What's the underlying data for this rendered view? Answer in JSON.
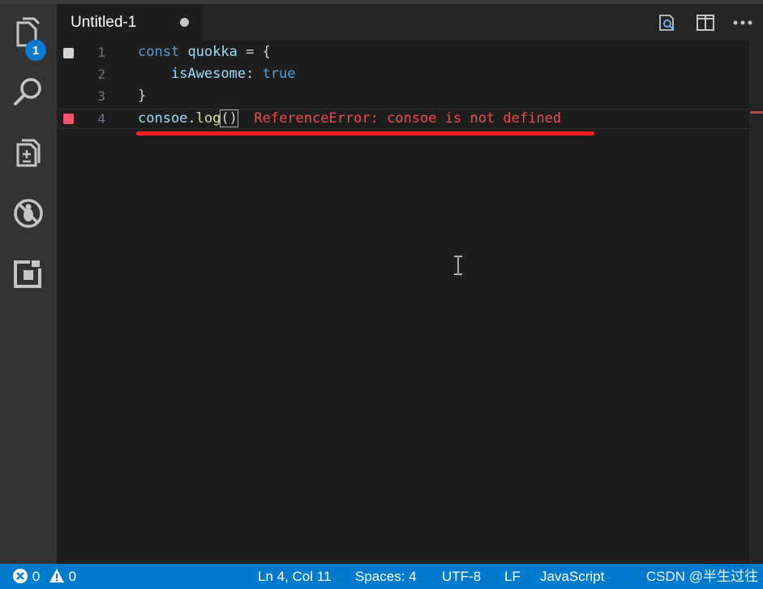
{
  "activity_bar": {
    "explorer_badge": "1",
    "items": [
      "explorer-icon",
      "search-icon",
      "source-control-icon",
      "debug-icon",
      "extensions-icon"
    ]
  },
  "tab": {
    "title": "Untitled-1",
    "dirty": true
  },
  "toolbar": {
    "icons": [
      "open-preview-icon",
      "split-editor-icon",
      "more-actions-icon"
    ]
  },
  "editor": {
    "lines": [
      {
        "number": "1",
        "coverage": "covered"
      },
      {
        "number": "2",
        "coverage": "none"
      },
      {
        "number": "3",
        "coverage": "none"
      },
      {
        "number": "4",
        "coverage": "error"
      }
    ],
    "code": {
      "line1_kw": "const",
      "line1_var": "quokka",
      "line1_rest": " = {",
      "line2_prop": "isAwesome",
      "line2_colon": ": ",
      "line2_val": "true",
      "line3": "}",
      "line4_obj": "consoe",
      "line4_dot": ".",
      "line4_fn": "log",
      "line4_args": "()"
    },
    "inline_error": "ReferenceError: consoe is not defined"
  },
  "statusbar": {
    "errors": "0",
    "warnings": "0",
    "position": "Ln 4, Col 11",
    "spaces": "Spaces: 4",
    "encoding": "UTF-8",
    "eol": "LF",
    "language": "JavaScript",
    "watermark": "CSDN @半生过往"
  },
  "colors": {
    "statusbar": "#007acc",
    "error": "#f14c4c",
    "underline": "#ff1f1f",
    "keyword": "#569cd6",
    "variable": "#9cdcfe",
    "function": "#dcdcaa"
  }
}
